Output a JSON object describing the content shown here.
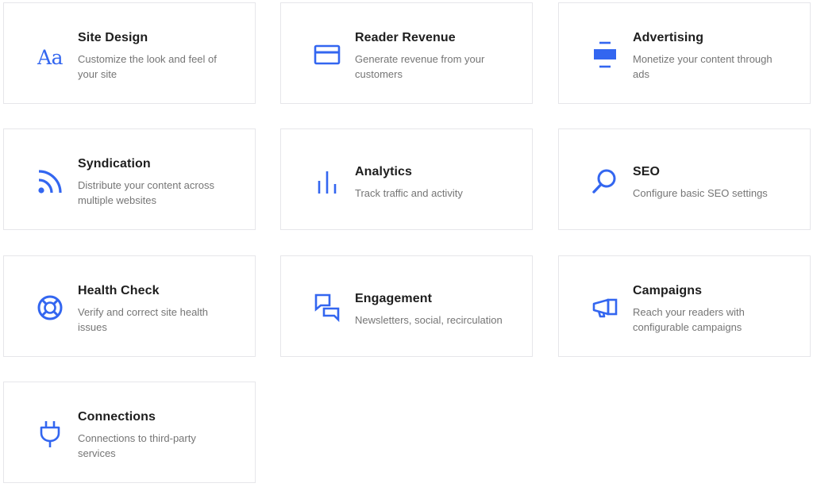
{
  "accent_color": "#3366f0",
  "cards": [
    {
      "id": "site-design",
      "title": "Site Design",
      "description": "Customize the look and feel of your site",
      "icon": "typography-icon"
    },
    {
      "id": "reader-revenue",
      "title": "Reader Revenue",
      "description": "Generate revenue from your customers",
      "icon": "credit-card-icon"
    },
    {
      "id": "advertising",
      "title": "Advertising",
      "description": "Monetize your content through ads",
      "icon": "ad-block-icon"
    },
    {
      "id": "syndication",
      "title": "Syndication",
      "description": "Distribute your content across multiple websites",
      "icon": "rss-icon"
    },
    {
      "id": "analytics",
      "title": "Analytics",
      "description": "Track traffic and activity",
      "icon": "bar-chart-icon"
    },
    {
      "id": "seo",
      "title": "SEO",
      "description": "Configure basic SEO settings",
      "icon": "search-icon"
    },
    {
      "id": "health-check",
      "title": "Health Check",
      "description": "Verify and correct site health issues",
      "icon": "lifebuoy-icon"
    },
    {
      "id": "engagement",
      "title": "Engagement",
      "description": "Newsletters, social, recirculation",
      "icon": "chat-bubbles-icon"
    },
    {
      "id": "campaigns",
      "title": "Campaigns",
      "description": "Reach your readers with configurable campaigns",
      "icon": "megaphone-icon"
    },
    {
      "id": "connections",
      "title": "Connections",
      "description": "Connections to third-party services",
      "icon": "plug-icon"
    }
  ],
  "icon_glyphs": {
    "typography": "Aa"
  }
}
